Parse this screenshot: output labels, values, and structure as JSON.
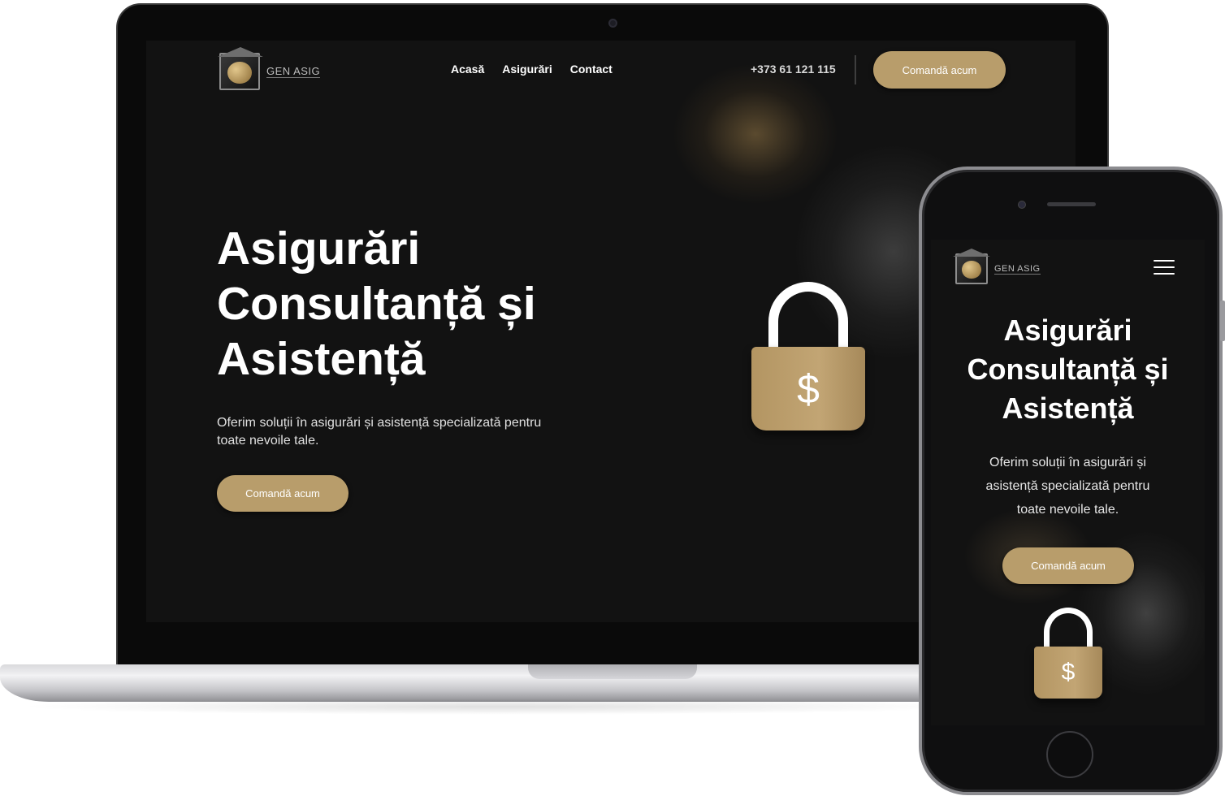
{
  "brand": {
    "logo_text": "GEN ASIG"
  },
  "nav": {
    "items": [
      "Acasă",
      "Asigurări",
      "Contact"
    ]
  },
  "header": {
    "phone": "+373 61 121 115",
    "cta_label": "Comandă acum"
  },
  "hero": {
    "title_lines": [
      "Asigurări",
      "Consultanță și",
      "Asistență"
    ],
    "mobile_title_lines": [
      "Asigurări",
      "Consultanță și",
      "Asistență"
    ],
    "subtitle_lines": [
      "Oferim soluții în asigurări și asistență specializată pentru",
      "toate nevoile tale."
    ],
    "mobile_subtitle_lines": [
      "Oferim soluții în asigurări și",
      "asistență specializată pentru",
      "toate nevoile tale."
    ],
    "cta_label": "Comandă acum",
    "lock_symbol": "$"
  },
  "icons": {
    "lock": "padlock-dollar-icon",
    "menu": "hamburger-menu-icon",
    "logo": "gen-asig-logo-icon"
  },
  "colors": {
    "accent": "#b89d6b",
    "background": "#121212",
    "text": "#ffffff"
  }
}
